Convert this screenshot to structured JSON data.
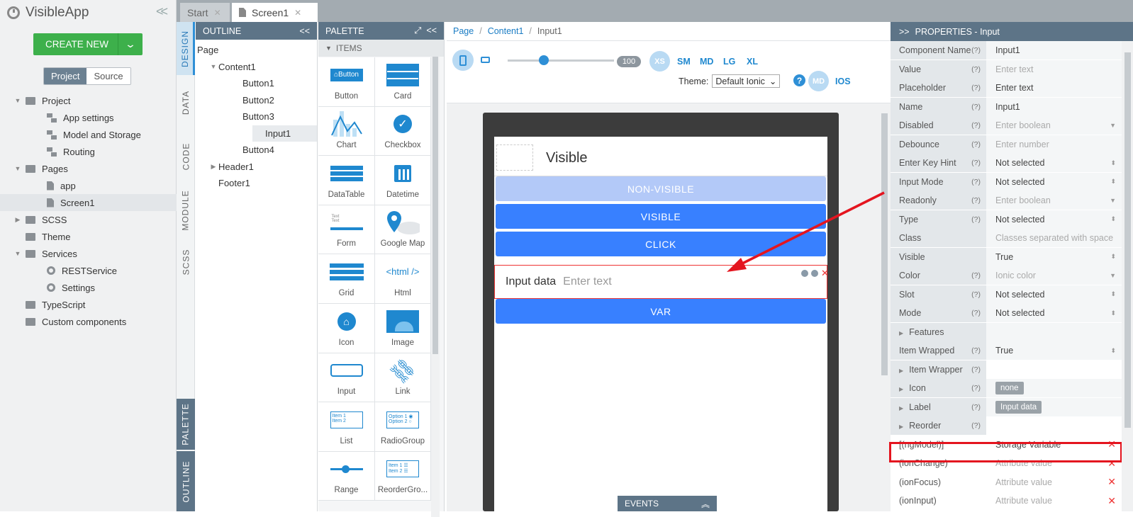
{
  "app": {
    "name": "VisibleApp"
  },
  "left": {
    "create_label": "CREATE NEW",
    "seg_tabs": [
      "Project",
      "Source"
    ],
    "tree": [
      {
        "label": "Project",
        "level": 0,
        "icon": "folder",
        "arrow": "▼"
      },
      {
        "label": "App settings",
        "level": 1,
        "icon": "multi"
      },
      {
        "label": "Model and Storage",
        "level": 1,
        "icon": "multi"
      },
      {
        "label": "Routing",
        "level": 1,
        "icon": "multi"
      },
      {
        "label": "Pages",
        "level": 0,
        "icon": "folder",
        "arrow": "▼"
      },
      {
        "label": "app",
        "level": 1,
        "icon": "file"
      },
      {
        "label": "Screen1",
        "level": 1,
        "icon": "file",
        "selected": true
      },
      {
        "label": "SCSS",
        "level": 0,
        "icon": "folder",
        "arrow": "▶"
      },
      {
        "label": "Theme",
        "level": 0,
        "icon": "folder"
      },
      {
        "label": "Services",
        "level": 0,
        "icon": "folder",
        "arrow": "▼"
      },
      {
        "label": "RESTService",
        "level": 1,
        "icon": "gear"
      },
      {
        "label": "Settings",
        "level": 1,
        "icon": "gear"
      },
      {
        "label": "TypeScript",
        "level": 0,
        "icon": "folder"
      },
      {
        "label": "Custom components",
        "level": 0,
        "icon": "folder"
      }
    ]
  },
  "tabs": [
    {
      "label": "Start"
    },
    {
      "label": "Screen1",
      "active": true
    }
  ],
  "side_tabs": {
    "top": [
      "DESIGN",
      "DATA",
      "CODE",
      "MODULE",
      "SCSS"
    ],
    "bottom": [
      "PALETTE",
      "OUTLINE"
    ]
  },
  "outline": {
    "title": "OUTLINE",
    "items": [
      {
        "label": "Page",
        "level": 0
      },
      {
        "label": "Content1",
        "level": 1,
        "arrow": "▼"
      },
      {
        "label": "Button1",
        "level": 2
      },
      {
        "label": "Button2",
        "level": 2
      },
      {
        "label": "Button3",
        "level": 2
      },
      {
        "label": "Input1",
        "level": 2,
        "selected": true
      },
      {
        "label": "Button4",
        "level": 2
      },
      {
        "label": "Header1",
        "level": 1,
        "arrow": "▶"
      },
      {
        "label": "Footer1",
        "level": 1
      }
    ]
  },
  "palette": {
    "title": "PALETTE",
    "section": "ITEMS",
    "items": [
      "Button",
      "Card",
      "Chart",
      "Checkbox",
      "DataTable",
      "Datetime",
      "Form",
      "Google Map",
      "Grid",
      "Html",
      "Icon",
      "Image",
      "Input",
      "Link",
      "List",
      "RadioGroup",
      "Range",
      "ReorderGro..."
    ]
  },
  "breadcrumb": [
    "Page",
    "Content1",
    "Input1"
  ],
  "toolbar": {
    "zoom": "100",
    "zoom_fraction": 0.34,
    "breakpoints": [
      "XS",
      "SM",
      "MD",
      "LG",
      "XL"
    ],
    "theme_label": "Theme:",
    "theme_value": "Default Ionic",
    "modes": [
      "MD",
      "IOS"
    ]
  },
  "screen": {
    "header_title": "Visible",
    "buttons": [
      {
        "label": "NON-VISIBLE",
        "color": "#b3c9f8"
      },
      {
        "label": "VISIBLE",
        "color": "#3880ff"
      },
      {
        "label": "CLICK",
        "color": "#3880ff"
      },
      {
        "label": "VAR",
        "color": "#3880ff"
      }
    ],
    "input_label": "Input data",
    "input_placeholder": "Enter text"
  },
  "events_label": "EVENTS",
  "properties": {
    "title": "PROPERTIES - Input",
    "rows": [
      {
        "key": "Component Name",
        "q": "(?)",
        "value": "Input1"
      },
      {
        "key": "Value",
        "q": "(?)",
        "value": "Enter text",
        "ph": true
      },
      {
        "key": "Placeholder",
        "q": "(?)",
        "value": "Enter text"
      },
      {
        "key": "Name",
        "q": "(?)",
        "value": "Input1"
      },
      {
        "key": "Disabled",
        "q": "(?)",
        "value": "Enter boolean",
        "ph": true,
        "dd": "▼"
      },
      {
        "key": "Debounce",
        "q": "(?)",
        "value": "Enter number",
        "ph": true
      },
      {
        "key": "Enter Key Hint",
        "q": "(?)",
        "value": "Not selected",
        "dd": "⬍"
      },
      {
        "key": "Input Mode",
        "q": "(?)",
        "value": "Not selected",
        "dd": "⬍"
      },
      {
        "key": "Readonly",
        "q": "(?)",
        "value": "Enter boolean",
        "ph": true,
        "dd": "▼"
      },
      {
        "key": "Type",
        "q": "(?)",
        "value": "Not selected",
        "dd": "⬍"
      },
      {
        "key": "Class",
        "q": "",
        "value": "Classes separated with space",
        "ph": true
      },
      {
        "key": "Visible",
        "q": "",
        "value": "True",
        "dd": "⬍"
      },
      {
        "key": "Color",
        "q": "(?)",
        "value": "Ionic color",
        "ph": true,
        "dd": "▼"
      },
      {
        "key": "Slot",
        "q": "(?)",
        "value": "Not selected",
        "dd": "⬍"
      },
      {
        "key": "Mode",
        "q": "(?)",
        "value": "Not selected",
        "dd": "⬍"
      },
      {
        "key": "Features",
        "q": "",
        "value": "",
        "group": true
      },
      {
        "key": "Item Wrapped",
        "q": "(?)",
        "value": "True",
        "dd": "⬍"
      },
      {
        "key": "Item Wrapper",
        "q": "(?)",
        "value": "",
        "group": true,
        "sub": true
      },
      {
        "key": "Icon",
        "q": "(?)",
        "value": "none",
        "group": true,
        "sub": true,
        "tag": true
      },
      {
        "key": "Label",
        "q": "(?)",
        "value": "Input data",
        "group": true,
        "sub": true,
        "tag": true
      },
      {
        "key": "Reorder",
        "q": "(?)",
        "value": "",
        "group": true,
        "sub": true
      },
      {
        "key": "[(ngModel)]",
        "q": "",
        "value": "Storage Variable",
        "ev": true,
        "x": true
      },
      {
        "key": "(ionChange)",
        "q": "",
        "value": "Attribute value",
        "ph": true,
        "ev": true,
        "x": true
      },
      {
        "key": "(ionFocus)",
        "q": "",
        "value": "Attribute value",
        "ph": true,
        "ev": true,
        "x": true
      },
      {
        "key": "(ionInput)",
        "q": "",
        "value": "Attribute value",
        "ph": true,
        "ev": true,
        "x": true
      }
    ]
  },
  "colors": {
    "accent": "#2e8fd6",
    "highlight": "#e4151f",
    "green": "#3db04b",
    "panel_head": "#5d7487"
  }
}
